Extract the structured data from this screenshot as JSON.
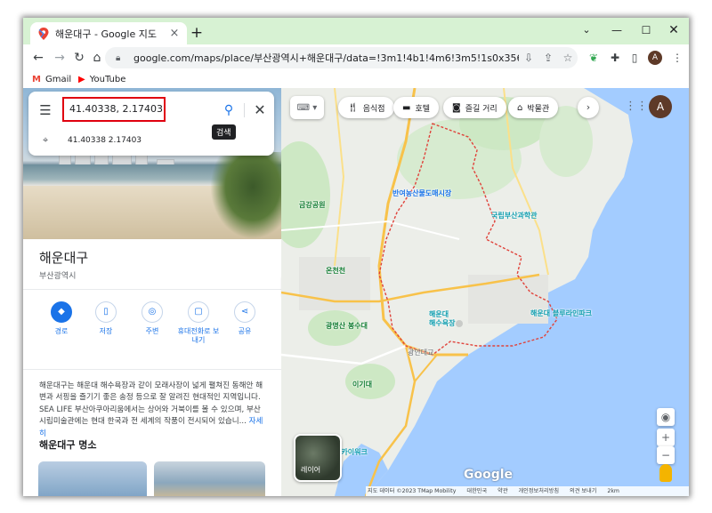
{
  "browser": {
    "tab_title": "해운대구 - Google 지도",
    "new_tab": "+",
    "tab_close": "×",
    "url": "google.com/maps/place/부산광역시+해운대구/data=!3m1!4b1!4m6!3m5!1s0x35688d9fdaeda...",
    "bookmarks": [
      {
        "label": "Gmail",
        "icon": "gmail-icon"
      },
      {
        "label": "YouTube",
        "icon": "youtube-icon"
      }
    ],
    "profile_initial": "A"
  },
  "search": {
    "query": "41.40338, 2.17403",
    "tooltip": "검색",
    "suggestion": "41.40338 2.17403"
  },
  "place": {
    "title": "해운대구",
    "subtitle": "부산광역시",
    "actions": [
      {
        "label": "경로",
        "icon": "directions-icon"
      },
      {
        "label": "저장",
        "icon": "bookmark-icon"
      },
      {
        "label": "주변",
        "icon": "nearby-icon"
      },
      {
        "label": "휴대전화로 보내기",
        "icon": "send-to-phone-icon"
      },
      {
        "label": "공유",
        "icon": "share-icon"
      }
    ],
    "description": "해운대구는 해운대 해수욕장과 같이 모래사장이 넓게 펼쳐진 동해안 해변과 서핑을 즐기기 좋은 송정 등으로 잘 알려진 현대적인 지역입니다. SEA LIFE 부산아쿠아리움에서는 상어와 거북이를 볼 수 있으며, 부산 시립미술관에는 현대 한국과 전 세계의 작품이 전시되어 있습니... ",
    "more_link": "자세히",
    "section_title": "해운대구 명소"
  },
  "map": {
    "chips": [
      {
        "label": "음식점",
        "icon": "restaurant-icon"
      },
      {
        "label": "호텔",
        "icon": "hotel-icon"
      },
      {
        "label": "즐길 거리",
        "icon": "camera-icon"
      },
      {
        "label": "박물관",
        "icon": "museum-icon"
      }
    ],
    "labels": {
      "geumgang_park": "금강공원",
      "banyeo_market": "반여농산물도매시장",
      "science_museum": "국립부산과학관",
      "oncheoncheon": "온천천",
      "haeundae_beach": "해운대\n해수욕장",
      "gwangalli": "광안대교",
      "igidae": "이기대",
      "skywalk": "스카이워크",
      "yongung_park": "광명산 봉수대",
      "gijang_rail": "해운대 블루라인파크"
    },
    "layers_label": "레이어",
    "google_logo": "Google",
    "footer": [
      "지도 데이터 ©2023 TMap Mobility",
      "대한민국",
      "약관",
      "개인정보처리방침",
      "의견 보내기",
      "2km"
    ],
    "zoom_in": "+",
    "zoom_out": "−"
  },
  "colors": {
    "accent": "#1a73e8",
    "highlight_border": "#e0000f",
    "boundary": "#e0433b",
    "water": "#a3ccff",
    "titlebar": "#d7f2d3"
  }
}
